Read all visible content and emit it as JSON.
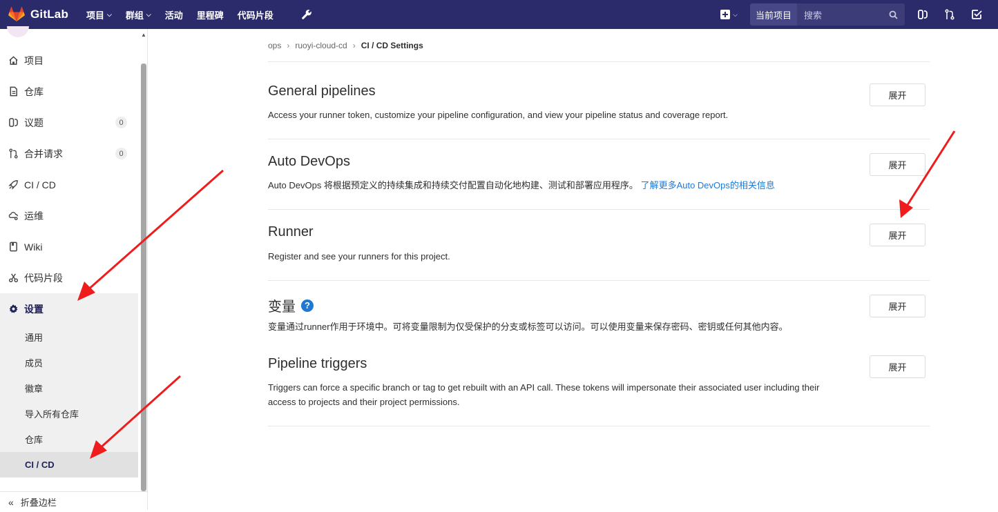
{
  "app": {
    "name": "GitLab",
    "brand_color": "#2b2b6b",
    "logo_colors": [
      "#e24329",
      "#fc6d26",
      "#fca326"
    ]
  },
  "topnav": {
    "items": [
      {
        "label": "项目",
        "dropdown": true
      },
      {
        "label": "群组",
        "dropdown": true
      },
      {
        "label": "活动",
        "dropdown": false
      },
      {
        "label": "里程碑",
        "dropdown": false
      },
      {
        "label": "代码片段",
        "dropdown": false
      }
    ],
    "admin_icon": "wrench-icon",
    "search_scope": "当前项目",
    "search_placeholder": "搜索",
    "right_icons": [
      "issues-icon",
      "merge-request-icon",
      "todo-icon"
    ]
  },
  "sidebar": {
    "items": [
      {
        "label": "项目",
        "icon": "home-icon"
      },
      {
        "label": "仓库",
        "icon": "doc-icon"
      },
      {
        "label": "议题",
        "icon": "issues-icon",
        "badge": "0"
      },
      {
        "label": "合并请求",
        "icon": "merge-request-icon",
        "badge": "0"
      },
      {
        "label": "CI / CD",
        "icon": "rocket-icon"
      },
      {
        "label": "运维",
        "icon": "cloud-icon"
      },
      {
        "label": "Wiki",
        "icon": "book-icon"
      },
      {
        "label": "代码片段",
        "icon": "scissors-icon"
      },
      {
        "label": "设置",
        "icon": "gear-icon",
        "active": true
      }
    ],
    "settings_sub": [
      {
        "label": "通用"
      },
      {
        "label": "成员"
      },
      {
        "label": "徽章"
      },
      {
        "label": "导入所有仓库"
      },
      {
        "label": "仓库"
      },
      {
        "label": "CI / CD",
        "active": true
      }
    ],
    "collapse_label": "折叠边栏"
  },
  "breadcrumb": {
    "items": [
      "ops",
      "ruoyi-cloud-cd",
      "CI / CD Settings"
    ]
  },
  "sections": [
    {
      "title": "General pipelines",
      "desc": "Access your runner token, customize your pipeline configuration, and view your pipeline status and coverage report.",
      "button": "展开"
    },
    {
      "title": "Auto DevOps",
      "desc": "Auto DevOps 将根据预定义的持续集成和持续交付配置自动化地构建、测试和部署应用程序。",
      "link": "了解更多Auto DevOps的相关信息",
      "button": "展开"
    },
    {
      "title": "Runner",
      "desc": "Register and see your runners for this project.",
      "button": "展开"
    },
    {
      "title": "变量",
      "help": "?",
      "desc": "变量通过runner作用于环境中。可将变量限制为仅受保护的分支或标签可以访问。可以使用变量来保存密码、密钥或任何其他内容。",
      "button": "展开"
    },
    {
      "title": "Pipeline triggers",
      "desc": "Triggers can force a specific branch or tag to get rebuilt with an API call. These tokens will impersonate their associated user including their access to projects and their project permissions.",
      "button": "展开"
    }
  ],
  "annotation_color": "#ee1c1c",
  "link_color": "#1f78d1"
}
